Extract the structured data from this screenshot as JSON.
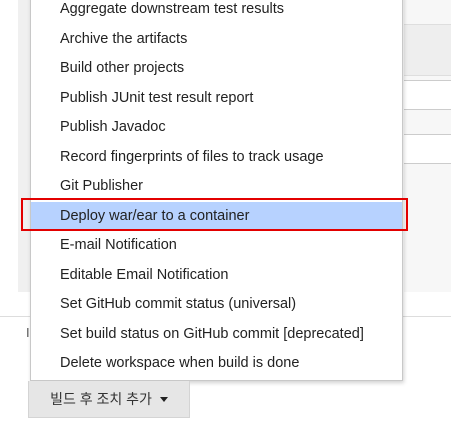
{
  "menu": {
    "items": [
      {
        "label": "Aggregate downstream test results",
        "selected": false
      },
      {
        "label": "Archive the artifacts",
        "selected": false
      },
      {
        "label": "Build other projects",
        "selected": false
      },
      {
        "label": "Publish JUnit test result report",
        "selected": false
      },
      {
        "label": "Publish Javadoc",
        "selected": false
      },
      {
        "label": "Record fingerprints of files to track usage",
        "selected": false
      },
      {
        "label": "Git Publisher",
        "selected": false
      },
      {
        "label": "Deploy war/ear to a container",
        "selected": true
      },
      {
        "label": "E-mail Notification",
        "selected": false
      },
      {
        "label": "Editable Email Notification",
        "selected": false
      },
      {
        "label": "Set GitHub commit status (universal)",
        "selected": false
      },
      {
        "label": "Set build status on GitHub commit [deprecated]",
        "selected": false
      },
      {
        "label": "Delete workspace when build is done",
        "selected": false
      }
    ]
  },
  "background": {
    "partial_label": "I"
  },
  "add_button": {
    "label": "빌드 후 조치 추가",
    "icon": "caret-down-icon"
  },
  "colors": {
    "selected_background": "#b7d2ff",
    "highlight_border": "#e30000",
    "button_background": "#e6e6e6"
  }
}
